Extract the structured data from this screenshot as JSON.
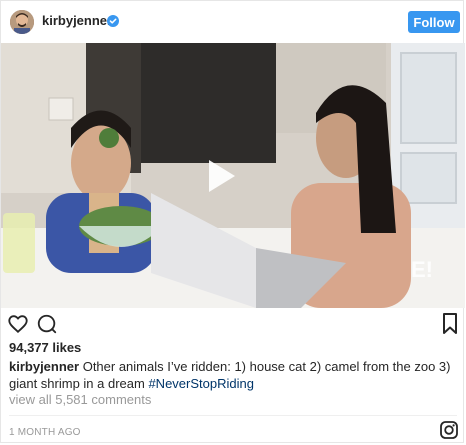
{
  "post": {
    "username": "kirbyjenner",
    "follow_label": "Follow",
    "likes": "94,377 likes",
    "caption_user": "kirbyjenner",
    "caption_text": " Other animals I’ve ridden: 1) house cat 2) camel from the zoo 3) giant shrimp in a dream ",
    "hashtag": "#NeverStopRiding",
    "view_comments": "view all 5,581 comments",
    "timestamp": "1 MONTH AGO",
    "watermark": "E!"
  },
  "icons": {
    "verified": "verified-badge-icon",
    "like": "heart-icon",
    "comment": "comment-icon",
    "save": "bookmark-icon",
    "play": "play-icon",
    "instagram": "instagram-icon"
  },
  "colors": {
    "follow_button": "#3897f0",
    "verified": "#3897f0",
    "hashtag": "#003569",
    "muted_text": "#999999"
  }
}
